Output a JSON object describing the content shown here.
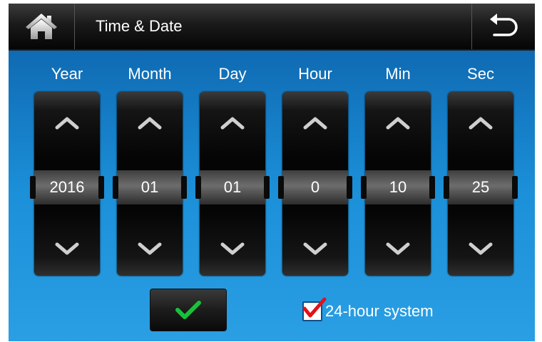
{
  "header": {
    "title": "Time & Date",
    "home_icon": "home-icon",
    "back_icon": "back-arrow-icon"
  },
  "columns": [
    {
      "label": "Year",
      "value": "2016"
    },
    {
      "label": "Month",
      "value": "01"
    },
    {
      "label": "Day",
      "value": "01"
    },
    {
      "label": "Hour",
      "value": "0"
    },
    {
      "label": "Min",
      "value": "10"
    },
    {
      "label": "Sec",
      "value": "25"
    }
  ],
  "footer": {
    "confirm_icon": "checkmark-icon",
    "confirm_color": "#19c13a",
    "option_label": "24-hour system",
    "option_checked": true,
    "check_color": "#e0121a"
  },
  "colors": {
    "background_top": "#0b5ea6",
    "background_bottom": "#2a9fe4",
    "topbar": "#111111"
  }
}
